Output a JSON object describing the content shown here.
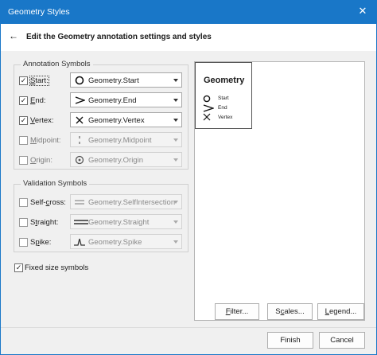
{
  "window": {
    "title": "Geometry Styles",
    "close_glyph": "✕"
  },
  "header": {
    "back_glyph": "←",
    "title": "Edit the Geometry annotation settings and styles"
  },
  "annotation": {
    "legend": "Annotation Symbols",
    "rows": [
      {
        "key": "S",
        "rest": "tart:",
        "checked": true,
        "value": "Geometry.Start",
        "icon": "circle-icon"
      },
      {
        "key": "E",
        "rest": "nd:",
        "checked": true,
        "value": "Geometry.End",
        "icon": "chevron-icon"
      },
      {
        "key": "V",
        "rest": "ertex:",
        "checked": true,
        "value": "Geometry.Vertex",
        "icon": "x-mark-icon"
      },
      {
        "key": "M",
        "rest": "idpoint:",
        "checked": false,
        "value": "Geometry.Midpoint",
        "icon": "tick-icon"
      },
      {
        "key": "O",
        "rest": "rigin:",
        "checked": false,
        "value": "Geometry.Origin",
        "icon": "target-icon"
      }
    ]
  },
  "validation": {
    "legend": "Validation Symbols",
    "rows": [
      {
        "pre": "Self-",
        "key": "c",
        "rest": "ross:",
        "checked": false,
        "value": "Geometry.SelfIntersection",
        "icon": "double-line-icon"
      },
      {
        "pre": "S",
        "key": "t",
        "rest": "raight:",
        "checked": false,
        "value": "Geometry.Straight",
        "icon": "straight-lines-icon"
      },
      {
        "pre": "S",
        "key": "p",
        "rest": "ike:",
        "checked": false,
        "value": "Geometry.Spike",
        "icon": "spike-icon"
      }
    ]
  },
  "fixed_size": {
    "label": "Fixed size symbols",
    "checked": true
  },
  "preview": {
    "title": "Geometry",
    "items": [
      {
        "label": "Start",
        "icon": "circle-icon"
      },
      {
        "label": "End",
        "icon": "chevron-icon"
      },
      {
        "label": "Vertex",
        "icon": "x-mark-icon"
      }
    ]
  },
  "buttons": {
    "filter": {
      "key": "F",
      "rest": "ilter..."
    },
    "scales": {
      "pre": "S",
      "key": "c",
      "rest": "ales..."
    },
    "legend": {
      "pre": "",
      "key": "L",
      "rest": "egend..."
    },
    "finish": "Finish",
    "cancel": "Cancel"
  },
  "check_glyph": "✓"
}
